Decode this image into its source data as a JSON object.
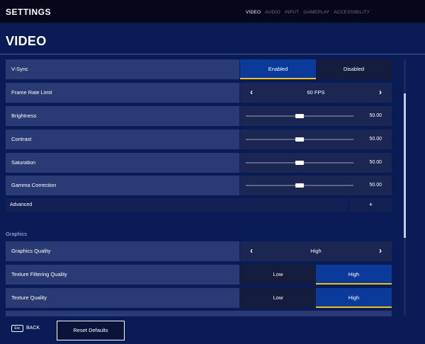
{
  "header": {
    "title": "SETTINGS",
    "tabs": [
      {
        "label": "VIDEO",
        "active": true
      },
      {
        "label": "AUDIO",
        "active": false
      },
      {
        "label": "INPUT",
        "active": false
      },
      {
        "label": "GAMEPLAY",
        "active": false
      },
      {
        "label": "ACCESSIBILITY",
        "active": false
      }
    ]
  },
  "page_title": "VIDEO",
  "settings": {
    "vsync": {
      "label": "V-Sync",
      "options": [
        "Enabled",
        "Disabled"
      ],
      "selected": "Enabled"
    },
    "frame_rate_limit": {
      "label": "Frame Rate Limit",
      "value": "60 FPS"
    },
    "brightness": {
      "label": "Brightness",
      "value": "50.00",
      "level": 0.5
    },
    "contrast": {
      "label": "Contrast",
      "value": "50.00",
      "level": 0.5
    },
    "saturation": {
      "label": "Saturation",
      "value": "50.00",
      "level": 0.5
    },
    "gamma_correction": {
      "label": "Gamma Correction",
      "value": "50.00",
      "level": 0.5
    },
    "advanced": {
      "label": "Advanced",
      "expand_symbol": "+"
    }
  },
  "graphics": {
    "section_label": "Graphics",
    "graphics_quality": {
      "label": "Graphics Quality",
      "value": "High"
    },
    "texture_filtering_quality": {
      "label": "Texture Filtering Quality",
      "options": [
        "Low",
        "High"
      ],
      "selected": "High"
    },
    "texture_quality": {
      "label": "Texture Quality",
      "options": [
        "Low",
        "High"
      ],
      "selected": "High"
    }
  },
  "footer": {
    "esc_key": "Esc",
    "back_label": "BACK",
    "reset_label": "Reset Defaults"
  },
  "icons": {
    "prev": "chevron-left-icon",
    "next": "chevron-right-icon",
    "prev_glyph": "‹",
    "next_glyph": "›"
  },
  "colors": {
    "background": "#0a1c55",
    "accent_underline": "#f2c21b",
    "selected_option": "#0a3a9a"
  }
}
